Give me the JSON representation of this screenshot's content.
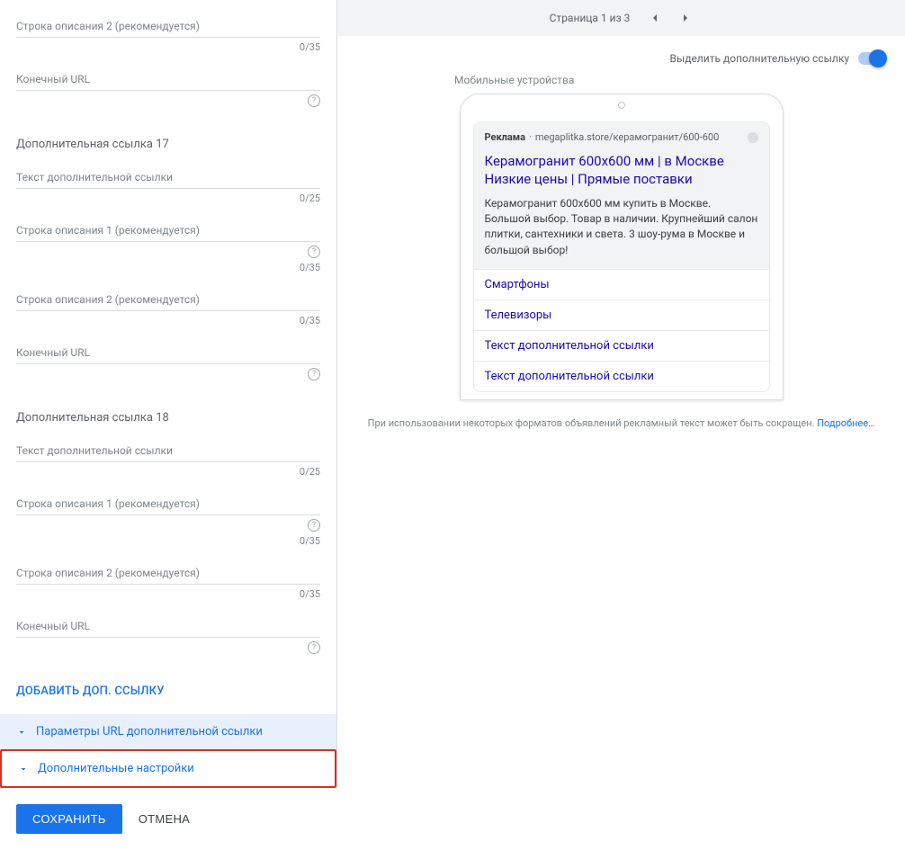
{
  "left": {
    "top_fields": [
      {
        "label": "Строка описания 2 (рекомендуется)",
        "counter": "0/35",
        "help": false
      },
      {
        "label": "Конечный URL",
        "counter": "",
        "help": true
      }
    ],
    "groups": [
      {
        "title": "Дополнительная ссылка 17",
        "fields": [
          {
            "label": "Текст дополнительной ссылки",
            "counter": "0/25",
            "help": false
          },
          {
            "label": "Строка описания 1 (рекомендуется)",
            "counter": "0/35",
            "help": true
          },
          {
            "label": "Строка описания 2 (рекомендуется)",
            "counter": "0/35",
            "help": false
          },
          {
            "label": "Конечный URL",
            "counter": "",
            "help": true
          }
        ]
      },
      {
        "title": "Дополнительная ссылка 18",
        "fields": [
          {
            "label": "Текст дополнительной ссылки",
            "counter": "0/25",
            "help": false
          },
          {
            "label": "Строка описания 1 (рекомендуется)",
            "counter": "0/35",
            "help": true
          },
          {
            "label": "Строка описания 2 (рекомендуется)",
            "counter": "0/35",
            "help": false
          },
          {
            "label": "Конечный URL",
            "counter": "",
            "help": true
          }
        ]
      }
    ],
    "add_link": "ДОБАВИТЬ ДОП. ССЫЛКУ",
    "expand1": "Параметры URL дополнительной ссылки",
    "expand2": "Дополнительные настройки",
    "save": "СОХРАНИТЬ",
    "cancel": "ОТМЕНА"
  },
  "right": {
    "pager": "Страница 1 из 3",
    "toggle_label": "Выделить дополнительную ссылку",
    "device_label": "Мобильные устройства",
    "ad": {
      "badge": "Реклама",
      "dot": "·",
      "url": "megaplitka.store/керамогранит/600-600",
      "title_line1": "Керамогранит 600х600 мм | в Москве",
      "title_line2": "Низкие цены | Прямые поставки",
      "desc": "Керамогранит 600х600 мм купить в Москве. Большой выбор. Товар в наличии. Крупнейший салон плитки, сантехники и света. 3 шоу-рума в Москве и большой выбор!",
      "sitelinks": [
        "Смартфоны",
        "Телевизоры",
        "Текст дополнительной ссылки",
        "Текст дополнительной ссылки"
      ]
    },
    "disclaimer_text": "При использовании некоторых форматов объявлений рекламный текст может быть сокращен. ",
    "disclaimer_link": "Подробнее…"
  }
}
